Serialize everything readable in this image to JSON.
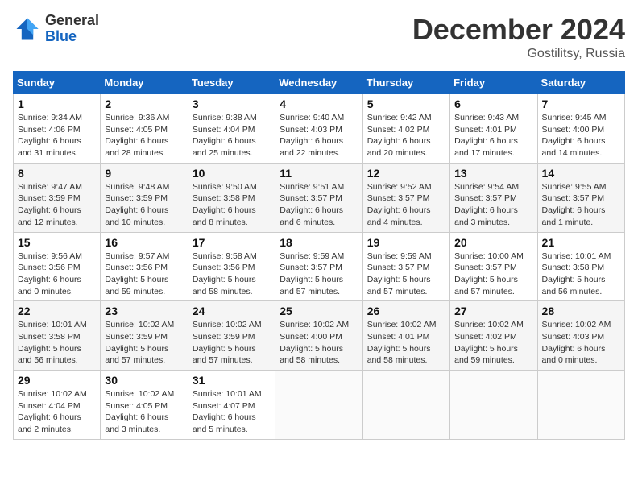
{
  "header": {
    "logo_general": "General",
    "logo_blue": "Blue",
    "month_title": "December 2024",
    "location": "Gostilitsy, Russia"
  },
  "days_of_week": [
    "Sunday",
    "Monday",
    "Tuesday",
    "Wednesday",
    "Thursday",
    "Friday",
    "Saturday"
  ],
  "weeks": [
    [
      {
        "day": "1",
        "sunrise": "Sunrise: 9:34 AM",
        "sunset": "Sunset: 4:06 PM",
        "daylight": "Daylight: 6 hours and 31 minutes."
      },
      {
        "day": "2",
        "sunrise": "Sunrise: 9:36 AM",
        "sunset": "Sunset: 4:05 PM",
        "daylight": "Daylight: 6 hours and 28 minutes."
      },
      {
        "day": "3",
        "sunrise": "Sunrise: 9:38 AM",
        "sunset": "Sunset: 4:04 PM",
        "daylight": "Daylight: 6 hours and 25 minutes."
      },
      {
        "day": "4",
        "sunrise": "Sunrise: 9:40 AM",
        "sunset": "Sunset: 4:03 PM",
        "daylight": "Daylight: 6 hours and 22 minutes."
      },
      {
        "day": "5",
        "sunrise": "Sunrise: 9:42 AM",
        "sunset": "Sunset: 4:02 PM",
        "daylight": "Daylight: 6 hours and 20 minutes."
      },
      {
        "day": "6",
        "sunrise": "Sunrise: 9:43 AM",
        "sunset": "Sunset: 4:01 PM",
        "daylight": "Daylight: 6 hours and 17 minutes."
      },
      {
        "day": "7",
        "sunrise": "Sunrise: 9:45 AM",
        "sunset": "Sunset: 4:00 PM",
        "daylight": "Daylight: 6 hours and 14 minutes."
      }
    ],
    [
      {
        "day": "8",
        "sunrise": "Sunrise: 9:47 AM",
        "sunset": "Sunset: 3:59 PM",
        "daylight": "Daylight: 6 hours and 12 minutes."
      },
      {
        "day": "9",
        "sunrise": "Sunrise: 9:48 AM",
        "sunset": "Sunset: 3:59 PM",
        "daylight": "Daylight: 6 hours and 10 minutes."
      },
      {
        "day": "10",
        "sunrise": "Sunrise: 9:50 AM",
        "sunset": "Sunset: 3:58 PM",
        "daylight": "Daylight: 6 hours and 8 minutes."
      },
      {
        "day": "11",
        "sunrise": "Sunrise: 9:51 AM",
        "sunset": "Sunset: 3:57 PM",
        "daylight": "Daylight: 6 hours and 6 minutes."
      },
      {
        "day": "12",
        "sunrise": "Sunrise: 9:52 AM",
        "sunset": "Sunset: 3:57 PM",
        "daylight": "Daylight: 6 hours and 4 minutes."
      },
      {
        "day": "13",
        "sunrise": "Sunrise: 9:54 AM",
        "sunset": "Sunset: 3:57 PM",
        "daylight": "Daylight: 6 hours and 3 minutes."
      },
      {
        "day": "14",
        "sunrise": "Sunrise: 9:55 AM",
        "sunset": "Sunset: 3:57 PM",
        "daylight": "Daylight: 6 hours and 1 minute."
      }
    ],
    [
      {
        "day": "15",
        "sunrise": "Sunrise: 9:56 AM",
        "sunset": "Sunset: 3:56 PM",
        "daylight": "Daylight: 6 hours and 0 minutes."
      },
      {
        "day": "16",
        "sunrise": "Sunrise: 9:57 AM",
        "sunset": "Sunset: 3:56 PM",
        "daylight": "Daylight: 5 hours and 59 minutes."
      },
      {
        "day": "17",
        "sunrise": "Sunrise: 9:58 AM",
        "sunset": "Sunset: 3:56 PM",
        "daylight": "Daylight: 5 hours and 58 minutes."
      },
      {
        "day": "18",
        "sunrise": "Sunrise: 9:59 AM",
        "sunset": "Sunset: 3:57 PM",
        "daylight": "Daylight: 5 hours and 57 minutes."
      },
      {
        "day": "19",
        "sunrise": "Sunrise: 9:59 AM",
        "sunset": "Sunset: 3:57 PM",
        "daylight": "Daylight: 5 hours and 57 minutes."
      },
      {
        "day": "20",
        "sunrise": "Sunrise: 10:00 AM",
        "sunset": "Sunset: 3:57 PM",
        "daylight": "Daylight: 5 hours and 57 minutes."
      },
      {
        "day": "21",
        "sunrise": "Sunrise: 10:01 AM",
        "sunset": "Sunset: 3:58 PM",
        "daylight": "Daylight: 5 hours and 56 minutes."
      }
    ],
    [
      {
        "day": "22",
        "sunrise": "Sunrise: 10:01 AM",
        "sunset": "Sunset: 3:58 PM",
        "daylight": "Daylight: 5 hours and 56 minutes."
      },
      {
        "day": "23",
        "sunrise": "Sunrise: 10:02 AM",
        "sunset": "Sunset: 3:59 PM",
        "daylight": "Daylight: 5 hours and 57 minutes."
      },
      {
        "day": "24",
        "sunrise": "Sunrise: 10:02 AM",
        "sunset": "Sunset: 3:59 PM",
        "daylight": "Daylight: 5 hours and 57 minutes."
      },
      {
        "day": "25",
        "sunrise": "Sunrise: 10:02 AM",
        "sunset": "Sunset: 4:00 PM",
        "daylight": "Daylight: 5 hours and 58 minutes."
      },
      {
        "day": "26",
        "sunrise": "Sunrise: 10:02 AM",
        "sunset": "Sunset: 4:01 PM",
        "daylight": "Daylight: 5 hours and 58 minutes."
      },
      {
        "day": "27",
        "sunrise": "Sunrise: 10:02 AM",
        "sunset": "Sunset: 4:02 PM",
        "daylight": "Daylight: 5 hours and 59 minutes."
      },
      {
        "day": "28",
        "sunrise": "Sunrise: 10:02 AM",
        "sunset": "Sunset: 4:03 PM",
        "daylight": "Daylight: 6 hours and 0 minutes."
      }
    ],
    [
      {
        "day": "29",
        "sunrise": "Sunrise: 10:02 AM",
        "sunset": "Sunset: 4:04 PM",
        "daylight": "Daylight: 6 hours and 2 minutes."
      },
      {
        "day": "30",
        "sunrise": "Sunrise: 10:02 AM",
        "sunset": "Sunset: 4:05 PM",
        "daylight": "Daylight: 6 hours and 3 minutes."
      },
      {
        "day": "31",
        "sunrise": "Sunrise: 10:01 AM",
        "sunset": "Sunset: 4:07 PM",
        "daylight": "Daylight: 6 hours and 5 minutes."
      },
      null,
      null,
      null,
      null
    ]
  ]
}
